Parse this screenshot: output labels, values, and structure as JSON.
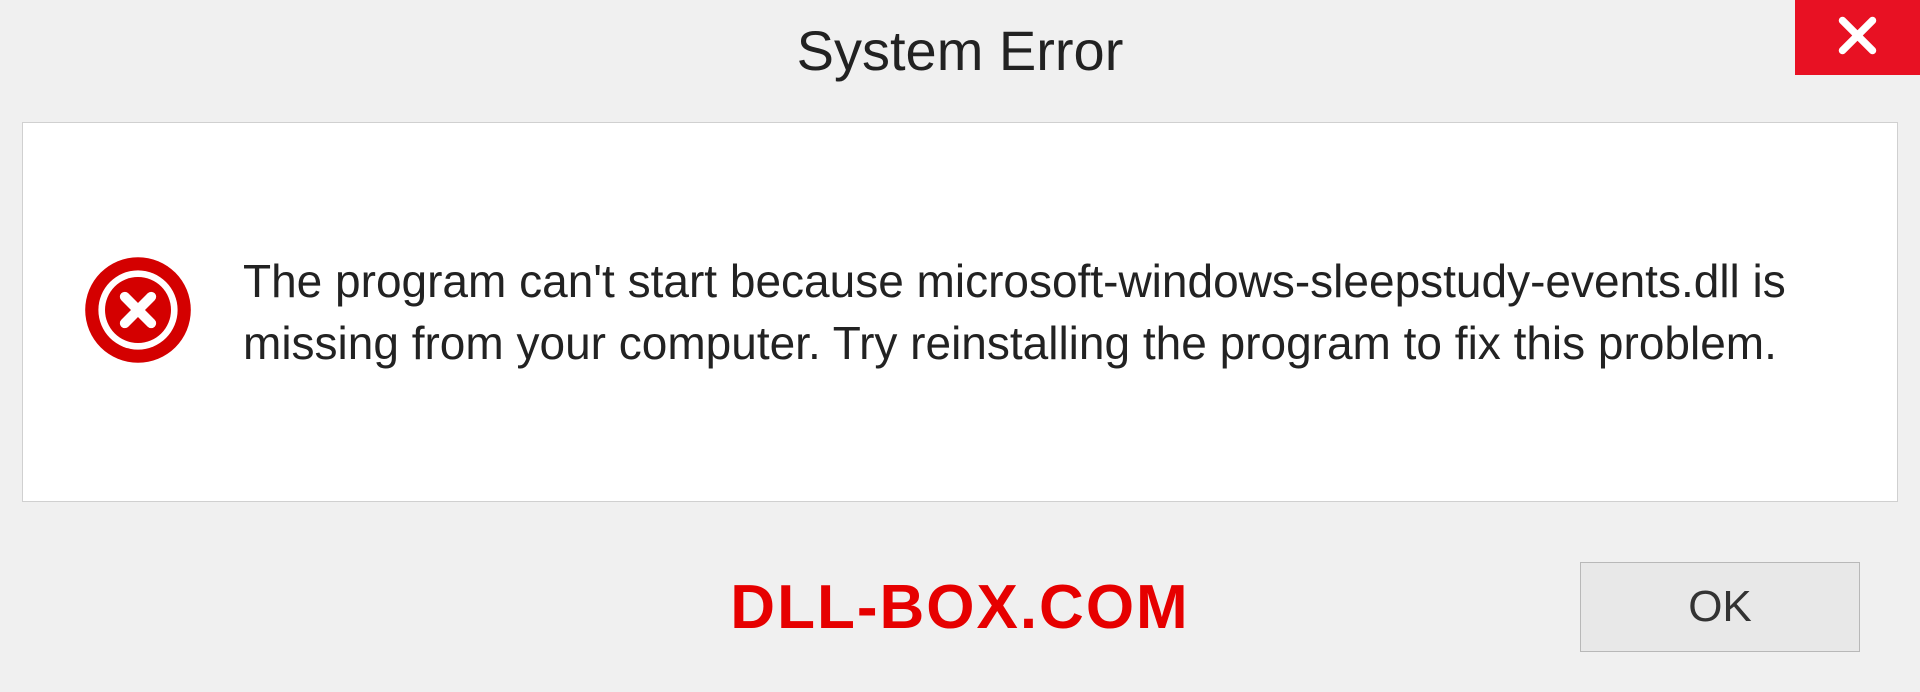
{
  "dialog": {
    "title": "System Error",
    "message": "The program can't start because microsoft-windows-sleepstudy-events.dll is missing from your computer. Try reinstalling the program to fix this problem.",
    "ok_label": "OK"
  },
  "watermark": "DLL-BOX.COM",
  "colors": {
    "close_bg": "#e81123",
    "error_red": "#d40000",
    "watermark_red": "#e60000"
  }
}
